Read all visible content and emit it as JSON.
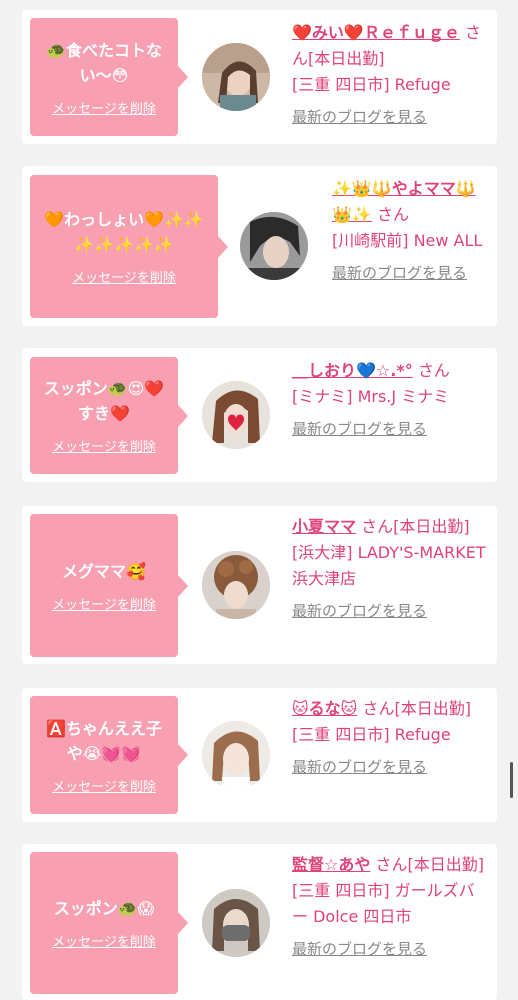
{
  "ui": {
    "delete_label": "メッセージを削除",
    "blog_label": "最新のブログを見る",
    "honorific": "さん"
  },
  "colors": {
    "background": "#f2f2f2",
    "card": "#ffffff",
    "bubble": "#f8a0b1",
    "accent_pink": "#e0437a",
    "link_gray": "#888888"
  },
  "messages": [
    {
      "message": "🐢食べたコトない〜😳",
      "name": "❤️みい❤️Ｒｅｆｕｇｅ",
      "status": "[本日出勤]",
      "shop": "[三重 四日市] Refuge"
    },
    {
      "message": "🧡わっしょい🧡✨✨✨✨✨✨✨",
      "name": "✨👑🔱やよママ🔱👑✨",
      "status": "",
      "shop": "[川崎駅前] New ALL"
    },
    {
      "message": "スッポン🐢😍❤️すき❤️",
      "name": "＿しおり💙☆.*°",
      "status": "",
      "shop": "[ミナミ] Mrs.J ミナミ"
    },
    {
      "message": "メグママ🥰",
      "name": "小夏ママ",
      "status": "[本日出勤]",
      "shop": "[浜大津] LADY'S-MARKET 浜大津店"
    },
    {
      "message": "🅰️ちゃんええ子や😭💓💓",
      "name": "🐱るな🐱",
      "status": "[本日出勤]",
      "shop": "[三重 四日市] Refuge"
    },
    {
      "message": "スッポン🐢😱",
      "name": "監督☆あや",
      "status": "[本日出勤]",
      "shop": "[三重 四日市] ガールズバー Dolce 四日市"
    }
  ]
}
